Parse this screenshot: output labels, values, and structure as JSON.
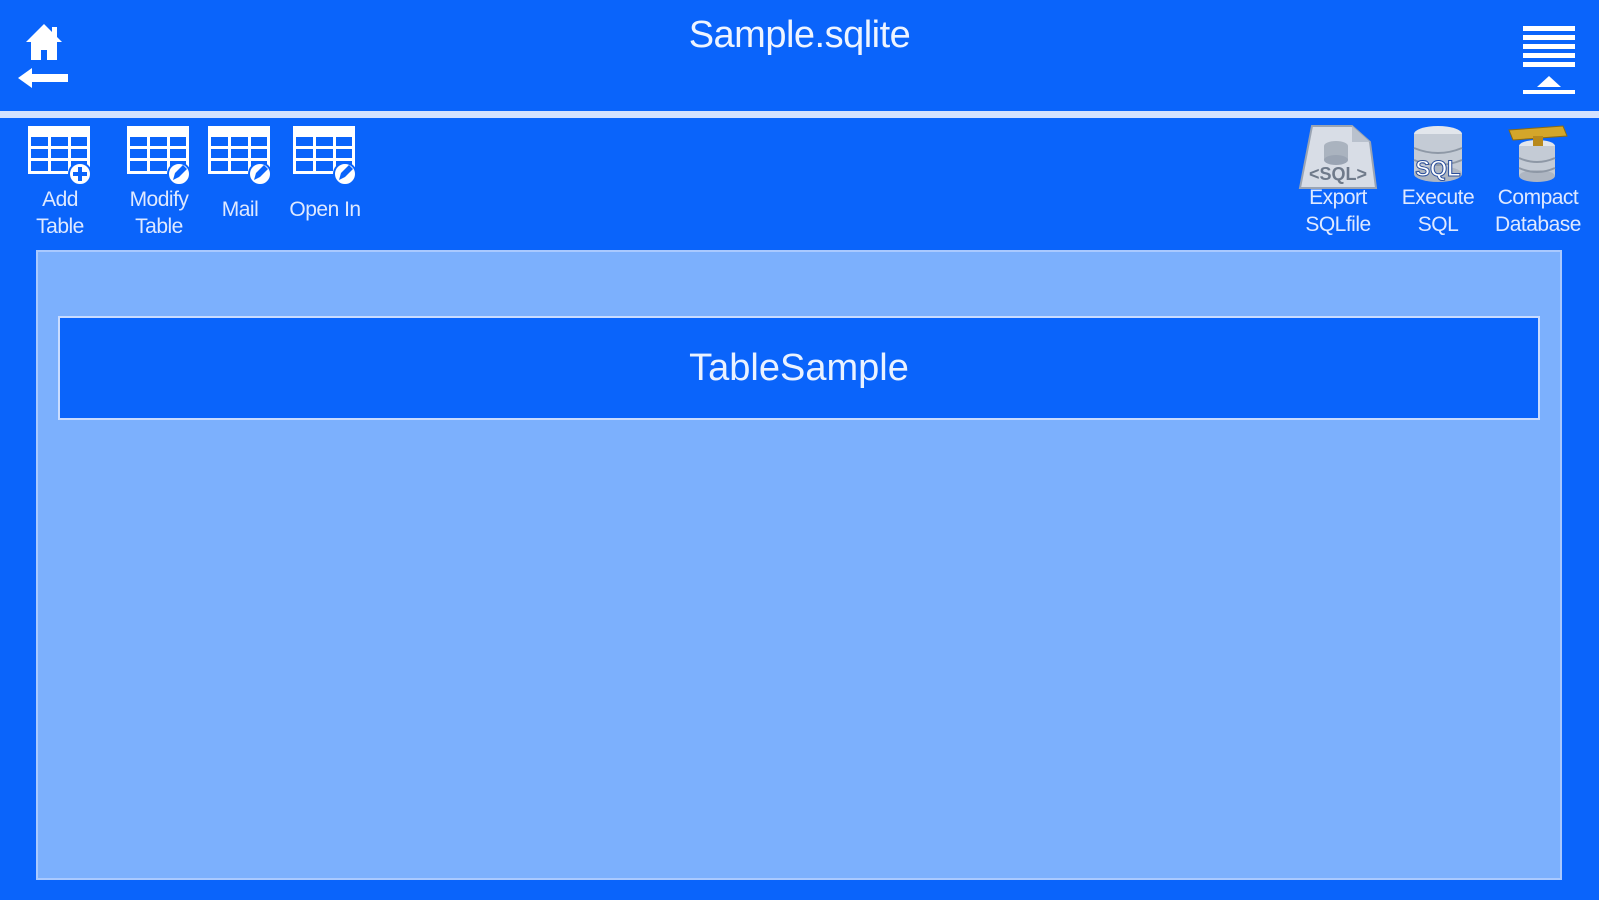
{
  "header": {
    "title": "Sample.sqlite",
    "home_icon": "home-back-icon",
    "menu_icon": "menu-icon"
  },
  "toolbar": {
    "left_items": [
      {
        "label": "Add\nTable",
        "icon": "add-table-icon"
      },
      {
        "label": "Modify\nTable",
        "icon": "modify-table-icon"
      },
      {
        "label": "Mail",
        "icon": "mail-table-icon"
      },
      {
        "label": "Open In",
        "icon": "open-in-table-icon"
      }
    ],
    "right_items": [
      {
        "label": "Export\nSQLfile",
        "icon": "export-sql-file-icon"
      },
      {
        "label": "Execute\nSQL",
        "icon": "execute-sql-icon"
      },
      {
        "label": "Compact\nDatabase",
        "icon": "compact-database-icon"
      }
    ]
  },
  "tables": [
    {
      "name": "TableSample"
    }
  ],
  "colors": {
    "background": "#0a64fb",
    "panel": "#7cb0fd",
    "rule": "#d3e2ff"
  }
}
